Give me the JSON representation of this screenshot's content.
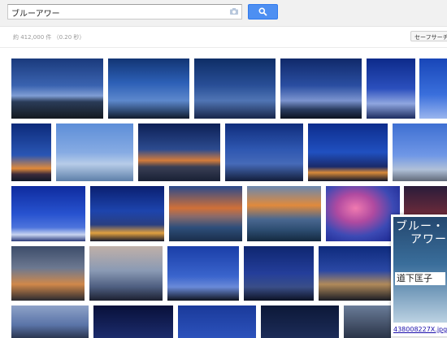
{
  "search": {
    "query": "ブルーアワー"
  },
  "stats": {
    "text": "約 412,000 件 （0.20 秒）"
  },
  "safesearch": {
    "label": "セーフサーチ"
  },
  "preview": {
    "book_title_line1": "ブルー・",
    "book_title_line2": "アワー",
    "book_author": "道下匡子",
    "filename": "438008227X.jpg"
  },
  "colors": {
    "accent": "#4d8ff2",
    "link": "#1a0dab"
  }
}
